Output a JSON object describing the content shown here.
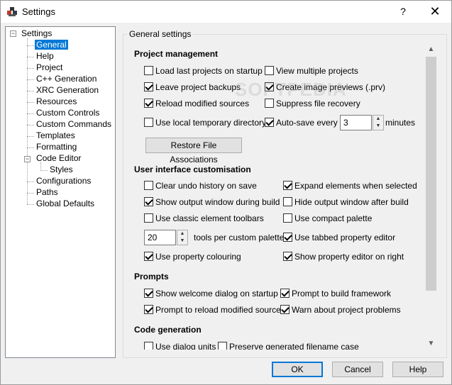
{
  "window": {
    "title": "Settings",
    "help_glyph": "?",
    "close_glyph": "✕"
  },
  "tree": {
    "root": "Settings",
    "items": [
      {
        "label": "General"
      },
      {
        "label": "Help"
      },
      {
        "label": "Project"
      },
      {
        "label": "C++ Generation"
      },
      {
        "label": "XRC Generation"
      },
      {
        "label": "Resources"
      },
      {
        "label": "Custom Controls"
      },
      {
        "label": "Custom Commands"
      },
      {
        "label": "Templates"
      },
      {
        "label": "Formatting"
      },
      {
        "label": "Code Editor"
      },
      {
        "label": "Styles"
      },
      {
        "label": "Configurations"
      },
      {
        "label": "Paths"
      },
      {
        "label": "Global Defaults"
      }
    ],
    "selected": "General"
  },
  "group_title": "General settings",
  "sections": {
    "project": "Project management",
    "ui": "User interface customisation",
    "prompts": "Prompts",
    "codegen": "Code generation"
  },
  "project": {
    "load_last": {
      "label": "Load last projects on startup",
      "checked": false
    },
    "view_multiple": {
      "label": "View multiple projects",
      "checked": false
    },
    "leave_backups": {
      "label": "Leave project backups",
      "checked": true
    },
    "create_previews": {
      "label": "Create image previews (.prv)",
      "checked": true
    },
    "reload_sources": {
      "label": "Reload modified sources",
      "checked": true
    },
    "suppress_recovery": {
      "label": "Suppress file recovery",
      "checked": false
    },
    "local_temp": {
      "label": "Use local temporary directory",
      "checked": false
    },
    "autosave": {
      "label": "Auto-save every",
      "checked": true
    },
    "autosave_value": "3",
    "autosave_unit": "minutes",
    "restore_button": "Restore File Associations"
  },
  "ui": {
    "clear_undo": {
      "label": "Clear undo history on save",
      "checked": false
    },
    "expand_selected": {
      "label": "Expand elements when selected",
      "checked": true
    },
    "show_output": {
      "label": "Show output window during build",
      "checked": true
    },
    "hide_output": {
      "label": "Hide output window after build",
      "checked": false
    },
    "classic_toolbars": {
      "label": "Use classic element toolbars",
      "checked": false
    },
    "compact_palette": {
      "label": "Use compact palette",
      "checked": false
    },
    "tools_value": "20",
    "tools_label": "tools per custom palette",
    "tabbed_editor": {
      "label": "Use tabbed property editor",
      "checked": true
    },
    "property_colouring": {
      "label": "Use property colouring",
      "checked": true
    },
    "editor_right": {
      "label": "Show property editor on right",
      "checked": true
    }
  },
  "prompts": {
    "welcome": {
      "label": "Show welcome dialog on startup",
      "checked": true
    },
    "build_framework": {
      "label": "Prompt to build framework",
      "checked": true
    },
    "reload_modified": {
      "label": "Prompt to reload modified sources",
      "checked": true
    },
    "warn_problems": {
      "label": "Warn about project problems",
      "checked": true
    }
  },
  "codegen": {
    "dialog_units": {
      "label": "Use dialog units",
      "checked": false
    },
    "preserve_case": {
      "label": "Preserve generated filename case",
      "checked": false
    }
  },
  "buttons": {
    "ok": "OK",
    "cancel": "Cancel",
    "help": "Help"
  },
  "colors": {
    "accent": "#0078d7",
    "background": "#f0f0f0"
  },
  "watermark": "SOFTPEDIA"
}
